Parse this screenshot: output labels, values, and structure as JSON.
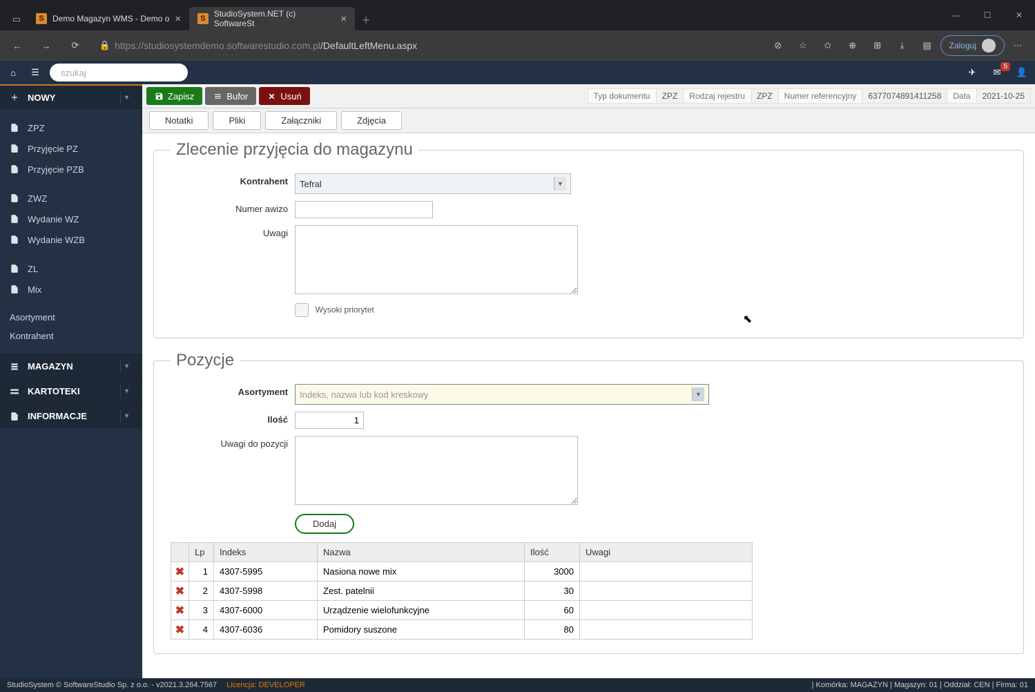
{
  "browser": {
    "tabs": [
      {
        "title": "Demo Magazyn WMS - Demo o",
        "active": false
      },
      {
        "title": "StudioSystem.NET (c) SoftwareSt",
        "active": true
      }
    ],
    "url_host": "https://studiosystemdemo.softwarestudio.com.pl",
    "url_path": "/DefaultLeftMenu.aspx",
    "login": "Zaloguj"
  },
  "header": {
    "search_placeholder": "szukaj",
    "badge": "5"
  },
  "sidebar": {
    "nowy": "NOWY",
    "group1": [
      "ZPZ",
      "Przyjęcie PZ",
      "Przyjęcie PZB"
    ],
    "group2": [
      "ZWZ",
      "Wydanie WZ",
      "Wydanie WZB"
    ],
    "group3": [
      "ZL",
      "Mix"
    ],
    "links": [
      "Asortyment",
      "Kontrahent"
    ],
    "sections": [
      "MAGAZYN",
      "KARTOTEKI",
      "INFORMACJE"
    ]
  },
  "toolbar": {
    "save": "Zapisz",
    "bufor": "Bufor",
    "delete": "Usuń",
    "meta": {
      "typ_label": "Typ dokumentu",
      "typ": "ZPZ",
      "rodzaj_label": "Rodzaj rejestru",
      "rodzaj": "ZPZ",
      "numer_label": "Numer referencyjny",
      "numer": "6377074891411258",
      "data_label": "Data",
      "data": "2021-10-25"
    }
  },
  "subtabs": [
    "Notatki",
    "Pliki",
    "Załączniki",
    "Zdjęcia"
  ],
  "form1": {
    "legend": "Zlecenie przyjęcia do magazynu",
    "kontrahent_label": "Kontrahent",
    "kontrahent_value": "Tefral",
    "awizo_label": "Numer awizo",
    "uwagi_label": "Uwagi",
    "wysoki": "Wysoki priorytet"
  },
  "form2": {
    "legend": "Pozycje",
    "asort_label": "Asortyment",
    "asort_placeholder": "Indeks, nazwa lub kod kreskowy",
    "ilosc_label": "Ilość",
    "ilosc_value": "1",
    "uwagi_label": "Uwagi do pozycji",
    "dodaj": "Dodaj"
  },
  "table": {
    "headers": {
      "lp": "Lp",
      "indeks": "Indeks",
      "nazwa": "Nazwa",
      "ilosc": "Ilość",
      "uwagi": "Uwagi"
    },
    "rows": [
      {
        "lp": "1",
        "indeks": "4307-5995",
        "nazwa": "Nasiona nowe mix",
        "ilosc": "3000",
        "uwagi": ""
      },
      {
        "lp": "2",
        "indeks": "4307-5998",
        "nazwa": "Zest. patelnii",
        "ilosc": "30",
        "uwagi": ""
      },
      {
        "lp": "3",
        "indeks": "4307-6000",
        "nazwa": "Urządzenie wielofunkcyjne",
        "ilosc": "60",
        "uwagi": ""
      },
      {
        "lp": "4",
        "indeks": "4307-6036",
        "nazwa": "Pomidory suszone",
        "ilosc": "80",
        "uwagi": ""
      }
    ]
  },
  "footer": {
    "left": "StudioSystem © SoftwareStudio Sp. z o.o. - v2021.3.264.7567",
    "lic_label": "Licencja:",
    "lic_value": "DEVELOPER",
    "right": "| Komórka: MAGAZYN | Magazyn: 01 | Oddział: CEN | Firma: 01"
  }
}
